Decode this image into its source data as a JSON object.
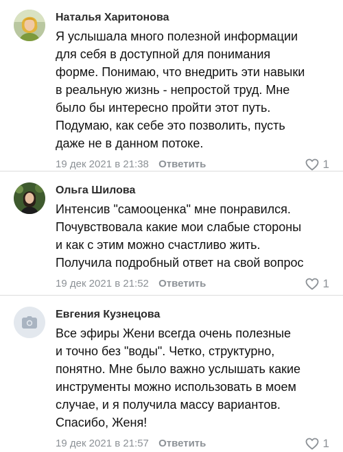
{
  "comments": [
    {
      "author": "Наталья Харитонова",
      "lines": [
        "Я услышала много полезной информации",
        "для себя в доступной для понимания",
        "форме. Понимаю, что внедрить эти навыки",
        "в реальную жизнь - непростой труд. Мне",
        "было бы интересно пройти этот путь.",
        "Подумаю, как себе это позволить, пусть",
        "даже не в данном потоке."
      ],
      "date": "19 дек 2021 в 21:38",
      "reply_label": "Ответить",
      "likes": "1",
      "avatar_icon": "user-photo"
    },
    {
      "author": "Ольга Шилова",
      "lines": [
        "Интенсив \"самооценка\" мне понравился.",
        "Почувствовала какие мои слабые стороны",
        "и как с этим можно счастливо жить.",
        "Получила подробный ответ на свой вопрос"
      ],
      "date": "19 дек 2021 в 21:52",
      "reply_label": "Ответить",
      "likes": "1",
      "avatar_icon": "user-photo"
    },
    {
      "author": "Евгения Кузнецова",
      "lines": [
        "Все эфиры Жени всегда очень полезные",
        "и точно без \"воды\". Четко, структурно,",
        "понятно. Мне было важно услышать какие",
        "инструменты можно использовать в моем",
        "случае, и я получила массу вариантов.",
        "Спасибо, Женя!"
      ],
      "date": "19 дек 2021 в 21:57",
      "reply_label": "Ответить",
      "likes": "1",
      "avatar_icon": "camera-icon"
    }
  ],
  "colors": {
    "meta_text": "#8c9196",
    "divider": "#dcdcdc",
    "placeholder_bg": "#e3e8ee"
  }
}
